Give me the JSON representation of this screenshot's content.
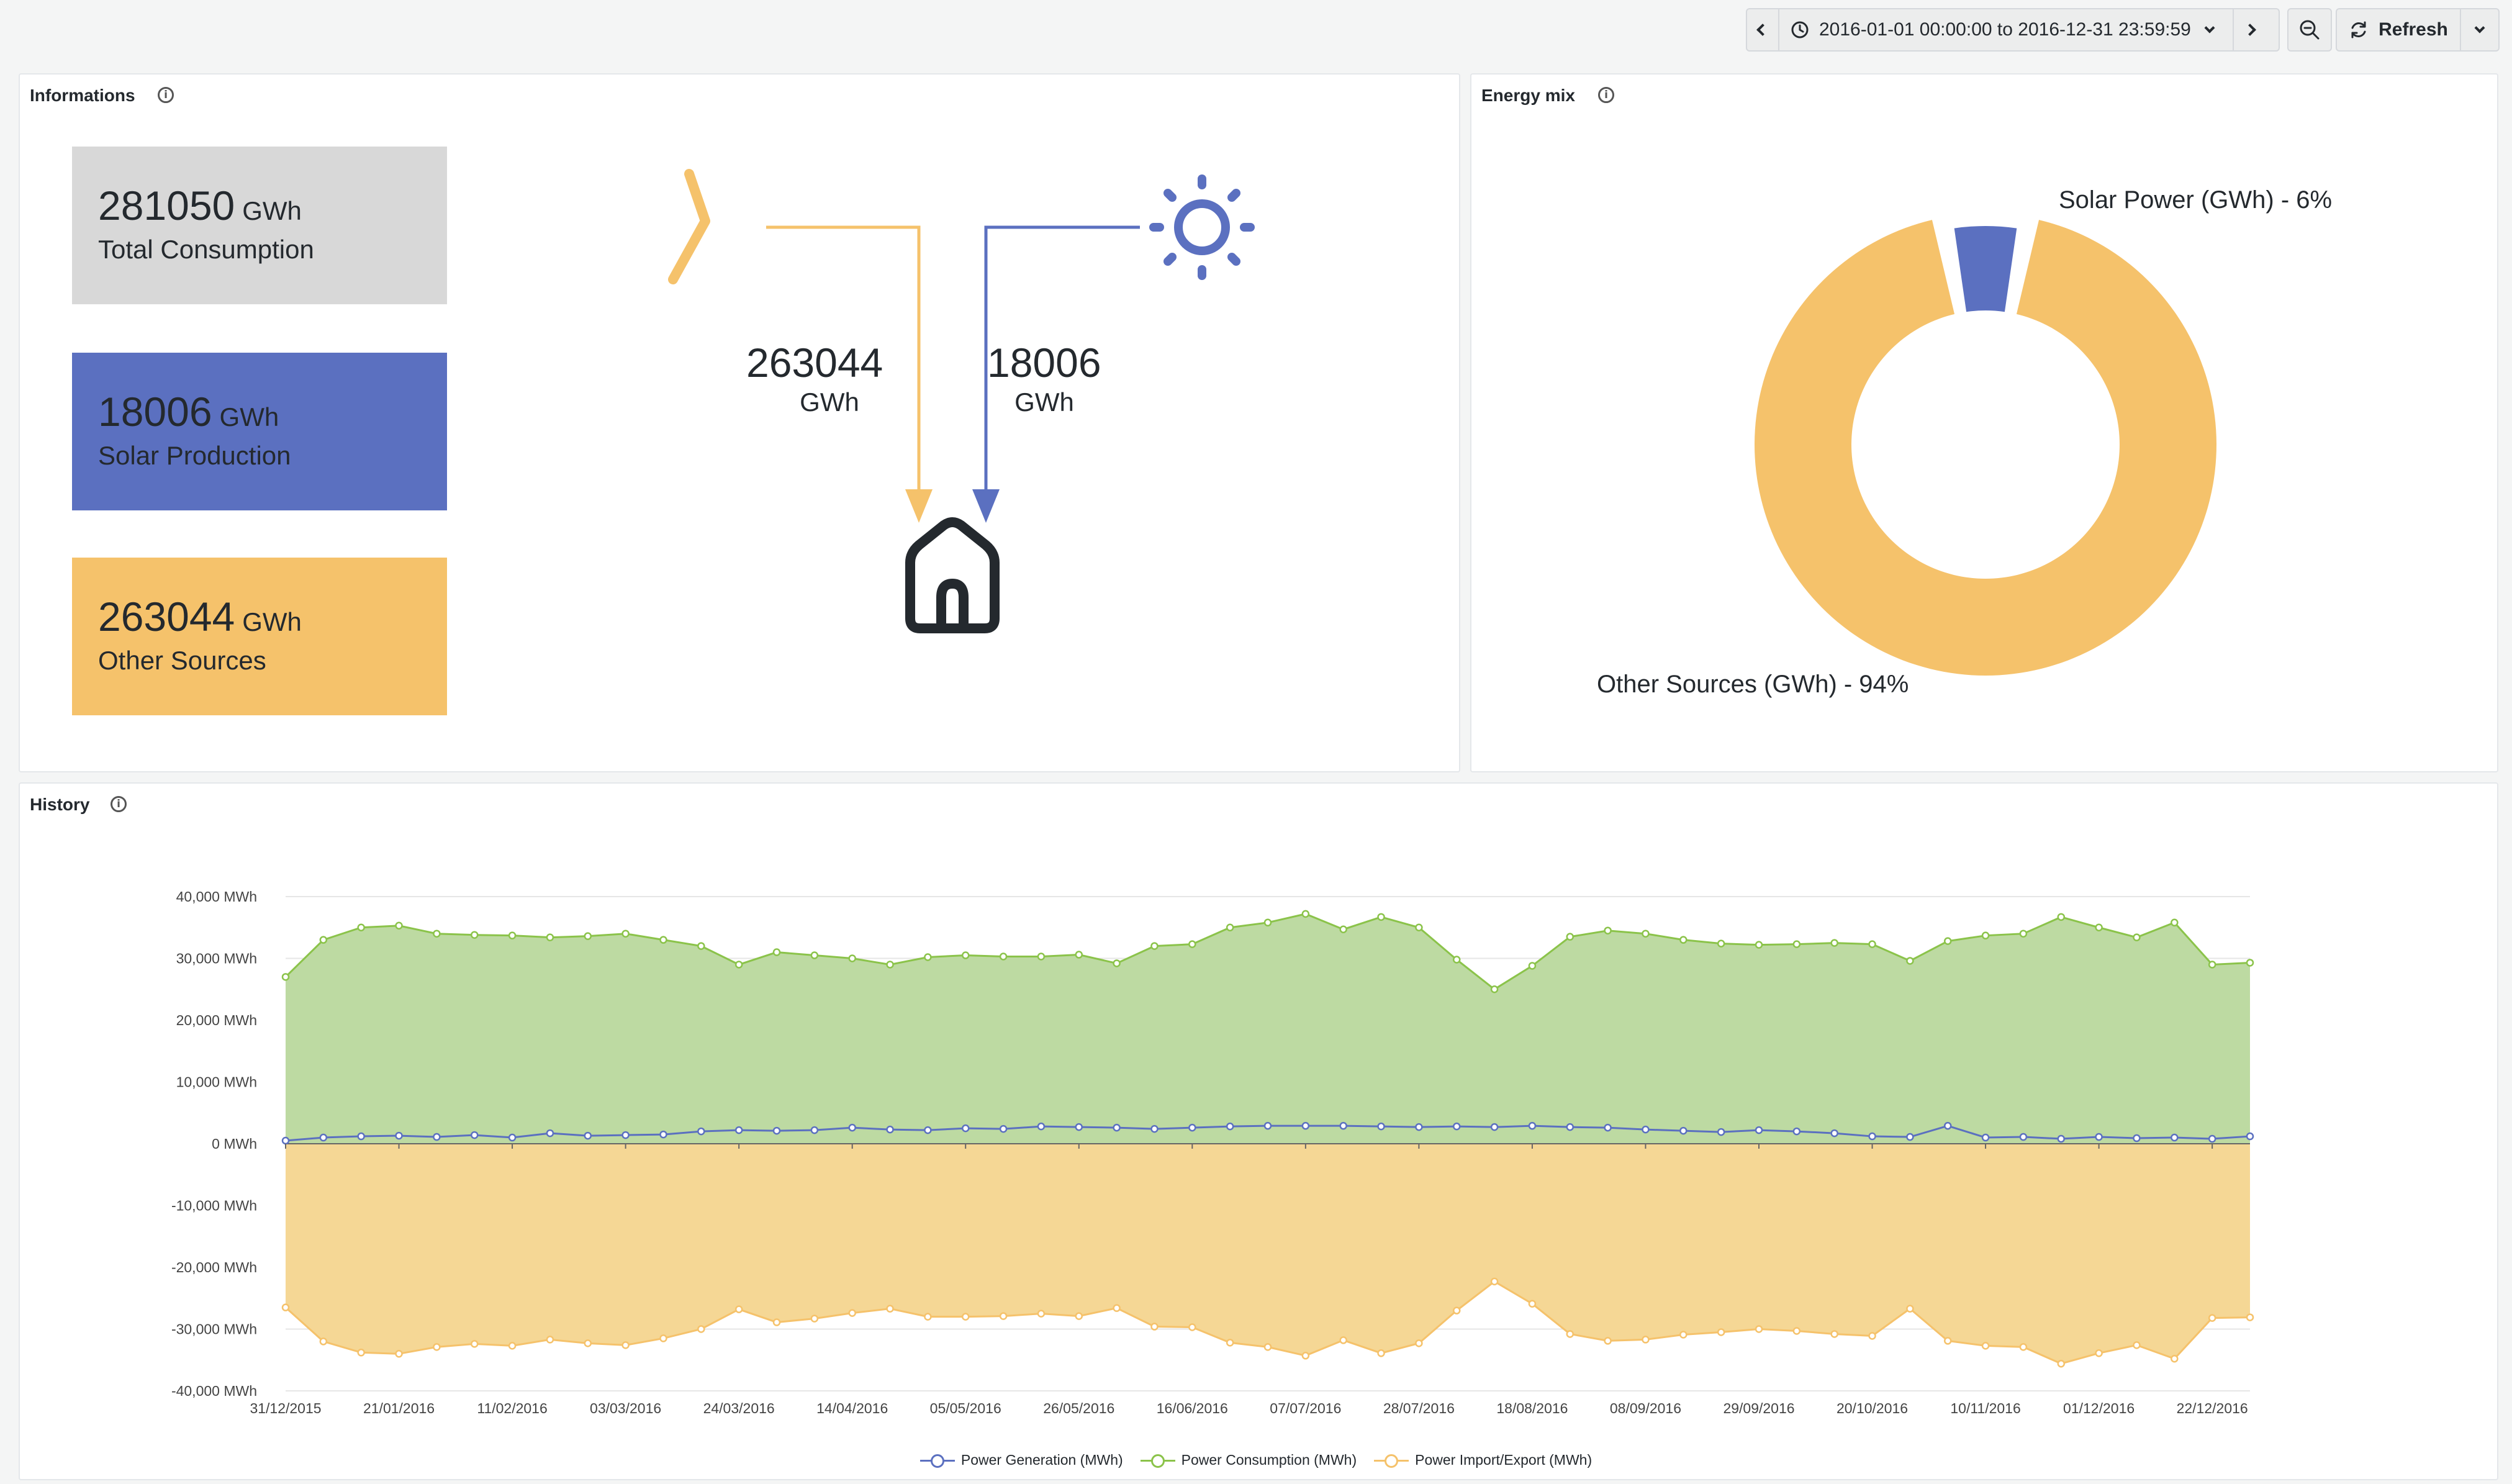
{
  "toolbar": {
    "time_range": "2016-01-01 00:00:00 to 2016-12-31 23:59:59",
    "refresh_label": "Refresh"
  },
  "info_panel": {
    "title": "Informations",
    "total_value": "281050",
    "total_unit": "GWh",
    "total_label": "Total Consumption",
    "solar_value": "18006",
    "solar_unit": "GWh",
    "solar_label": "Solar Production",
    "other_value": "263044",
    "other_unit": "GWh",
    "other_label": "Other Sources",
    "flow_grid_value": "263044",
    "flow_grid_unit": "GWh",
    "flow_solar_value": "18006",
    "flow_solar_unit": "GWh"
  },
  "energy_mix": {
    "title": "Energy mix",
    "solar_label": "Solar Power (GWh) - 6%",
    "other_label": "Other Sources (GWh) - 94%",
    "solar_percent": 6,
    "other_percent": 94
  },
  "history": {
    "title": "History"
  },
  "colors": {
    "solar": "#5b70c0",
    "other": "#f5c26b",
    "consumption": "#8bc34a",
    "total_card": "#d8d8d8"
  },
  "icons": [
    "info-icon",
    "lightning-icon",
    "sun-icon",
    "house-icon",
    "clock-icon",
    "refresh-icon",
    "zoom-out-icon"
  ],
  "chart_data": {
    "type": "area",
    "x": [
      "31/12/2015",
      "07/01/2016",
      "14/01/2016",
      "21/01/2016",
      "28/01/2016",
      "04/02/2016",
      "11/02/2016",
      "18/02/2016",
      "25/02/2016",
      "03/03/2016",
      "10/03/2016",
      "17/03/2016",
      "24/03/2016",
      "31/03/2016",
      "07/04/2016",
      "14/04/2016",
      "21/04/2016",
      "28/04/2016",
      "05/05/2016",
      "12/05/2016",
      "19/05/2016",
      "26/05/2016",
      "02/06/2016",
      "09/06/2016",
      "16/06/2016",
      "23/06/2016",
      "30/06/2016",
      "07/07/2016",
      "14/07/2016",
      "21/07/2016",
      "28/07/2016",
      "04/08/2016",
      "11/08/2016",
      "18/08/2016",
      "25/08/2016",
      "01/09/2016",
      "08/09/2016",
      "15/09/2016",
      "22/09/2016",
      "29/09/2016",
      "06/10/2016",
      "13/10/2016",
      "20/10/2016",
      "27/10/2016",
      "03/11/2016",
      "10/11/2016",
      "17/11/2016",
      "24/11/2016",
      "01/12/2016",
      "08/12/2016",
      "15/12/2016",
      "22/12/2016",
      "29/12/2016"
    ],
    "x_tick_labels": [
      "31/12/2015",
      "21/01/2016",
      "11/02/2016",
      "03/03/2016",
      "24/03/2016",
      "14/04/2016",
      "05/05/2016",
      "26/05/2016",
      "16/06/2016",
      "07/07/2016",
      "28/07/2016",
      "18/08/2016",
      "08/09/2016",
      "29/09/2016",
      "20/10/2016",
      "10/11/2016",
      "01/12/2016",
      "22/12/2016"
    ],
    "y_tick_labels": [
      "40,000 MWh",
      "30,000 MWh",
      "20,000 MWh",
      "10,000 MWh",
      "0 MWh",
      "-10,000 MWh",
      "-20,000 MWh",
      "-30,000 MWh",
      "-40,000 MWh"
    ],
    "ylim": [
      -40000,
      40000
    ],
    "grid": true,
    "legend_position": "bottom",
    "series": [
      {
        "name": "Power Generation (MWh)",
        "color": "#5b70c0",
        "values": [
          500,
          1000,
          1200,
          1300,
          1100,
          1400,
          1000,
          1700,
          1300,
          1400,
          1500,
          2000,
          2200,
          2100,
          2200,
          2600,
          2300,
          2200,
          2500,
          2400,
          2800,
          2700,
          2600,
          2400,
          2600,
          2800,
          2900,
          2900,
          2900,
          2800,
          2700,
          2800,
          2700,
          2900,
          2700,
          2600,
          2300,
          2100,
          1900,
          2200,
          2000,
          1700,
          1200,
          1100,
          2900,
          1000,
          1100,
          800,
          1100,
          900,
          1000,
          800,
          1200
        ]
      },
      {
        "name": "Power Consumption (MWh)",
        "color": "#8bc34a",
        "values": [
          27000,
          33000,
          35000,
          35300,
          34000,
          33800,
          33700,
          33400,
          33600,
          34000,
          33000,
          32000,
          29000,
          31000,
          30500,
          30000,
          29000,
          30200,
          30500,
          30300,
          30300,
          30600,
          29200,
          32000,
          32300,
          35000,
          35800,
          37200,
          34700,
          36700,
          35000,
          29800,
          25000,
          28800,
          33500,
          34500,
          34000,
          33000,
          32400,
          32200,
          32300,
          32500,
          32300,
          29600,
          32800,
          33700,
          34000,
          36700,
          35000,
          33400,
          35800,
          29000,
          29300
        ]
      },
      {
        "name": "Power Import/Export (MWh)",
        "color": "#f5c26b",
        "values": [
          -26500,
          -32000,
          -33800,
          -34000,
          -32900,
          -32400,
          -32700,
          -31700,
          -32300,
          -32600,
          -31500,
          -30000,
          -26800,
          -28900,
          -28300,
          -27400,
          -26700,
          -28000,
          -28000,
          -27900,
          -27500,
          -27900,
          -26600,
          -29600,
          -29700,
          -32200,
          -32900,
          -34300,
          -31800,
          -33900,
          -32300,
          -27000,
          -22300,
          -25900,
          -30800,
          -31900,
          -31700,
          -30900,
          -30500,
          -30000,
          -30300,
          -30800,
          -31100,
          -26700,
          -31900,
          -32700,
          -32900,
          -35600,
          -33900,
          -32600,
          -34800,
          -28200,
          -28100
        ]
      }
    ]
  }
}
